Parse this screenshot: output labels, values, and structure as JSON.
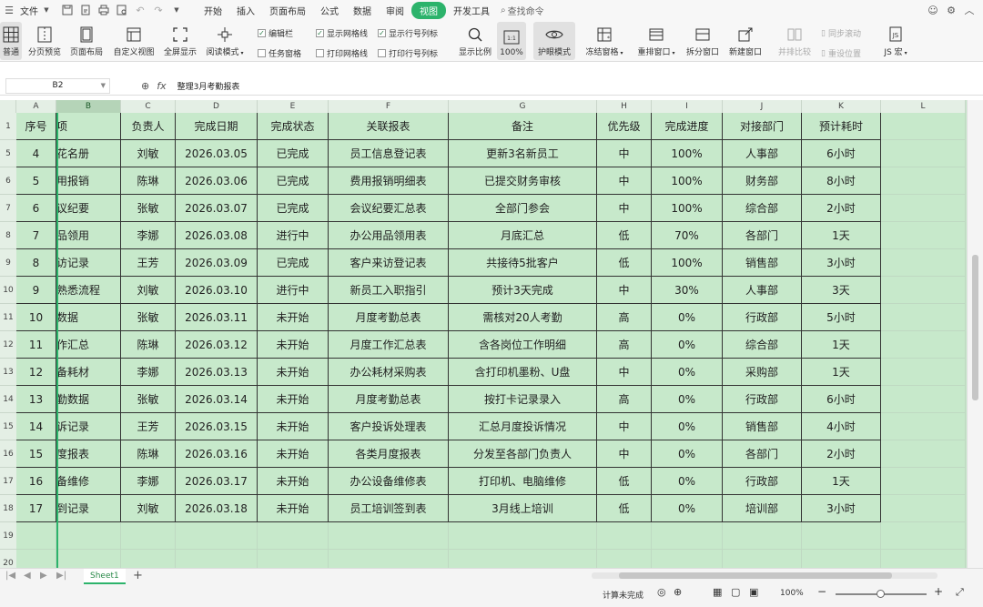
{
  "menu": {
    "file_label": "文件",
    "tabs": [
      "开始",
      "插入",
      "页面布局",
      "公式",
      "数据",
      "审阅",
      "视图",
      "开发工具"
    ],
    "active_tab": "视图",
    "search_label": "查找命令"
  },
  "ribbon": {
    "normal": "普通",
    "page_break_preview": "分页预览",
    "page_layout": "页面布局",
    "custom_view": "自定义视图",
    "full_screen": "全屏显示",
    "reading_mode": "阅读模式",
    "edit_bar": "编辑栏",
    "task_pane": "任务窗格",
    "show_gridlines": "显示网格线",
    "print_gridlines": "打印网格线",
    "show_row_col_headers": "显示行号列标",
    "print_row_col_headers": "打印行号列标",
    "zoom": "显示比例",
    "zoom_100": "100%",
    "eye_mode": "护眼模式",
    "freeze_panes": "冻结窗格",
    "arrange_windows": "重排窗口",
    "split_window": "拆分窗口",
    "new_window": "新建窗口",
    "side_by_side": "并排比较",
    "sync_scroll": "同步滚动",
    "reset_position": "重设位置",
    "js_macro": "JS 宏",
    "icon_normal": "grid-icon"
  },
  "formula_bar": {
    "cell_ref": "B2",
    "fx": "fx",
    "formula": "整理3月考勤报表"
  },
  "columns": [
    "A",
    "B",
    "C",
    "D",
    "E",
    "F",
    "G",
    "H",
    "I",
    "J",
    "K",
    "L"
  ],
  "header_row": {
    "row_num": "1",
    "cells": [
      "序号",
      "项",
      "负责人",
      "完成日期",
      "完成状态",
      "关联报表",
      "备注",
      "优先级",
      "完成进度",
      "对接部门",
      "预计耗时"
    ]
  },
  "rows": [
    {
      "num": "5",
      "cells": [
        "4",
        "花名册",
        "刘敏",
        "2026.03.05",
        "已完成",
        "员工信息登记表",
        "更新3名新员工",
        "中",
        "100%",
        "人事部",
        "6小时"
      ]
    },
    {
      "num": "6",
      "cells": [
        "5",
        "用报销",
        "陈琳",
        "2026.03.06",
        "已完成",
        "费用报销明细表",
        "已提交财务审核",
        "中",
        "100%",
        "财务部",
        "8小时"
      ]
    },
    {
      "num": "7",
      "cells": [
        "6",
        "议纪要",
        "张敏",
        "2026.03.07",
        "已完成",
        "会议纪要汇总表",
        "全部门参会",
        "中",
        "100%",
        "综合部",
        "2小时"
      ]
    },
    {
      "num": "8",
      "cells": [
        "7",
        "品领用",
        "李娜",
        "2026.03.08",
        "进行中",
        "办公用品领用表",
        "月底汇总",
        "低",
        "70%",
        "各部门",
        "1天"
      ]
    },
    {
      "num": "9",
      "cells": [
        "8",
        "访记录",
        "王芳",
        "2026.03.09",
        "已完成",
        "客户来访登记表",
        "共接待5批客户",
        "低",
        "100%",
        "销售部",
        "3小时"
      ]
    },
    {
      "num": "10",
      "cells": [
        "9",
        "熟悉流程",
        "刘敏",
        "2026.03.10",
        "进行中",
        "新员工入职指引",
        "预计3天完成",
        "中",
        "30%",
        "人事部",
        "3天"
      ]
    },
    {
      "num": "11",
      "cells": [
        "10",
        "数据",
        "张敏",
        "2026.03.11",
        "未开始",
        "月度考勤总表",
        "需核对20人考勤",
        "高",
        "0%",
        "行政部",
        "5小时"
      ]
    },
    {
      "num": "12",
      "cells": [
        "11",
        "作汇总",
        "陈琳",
        "2026.03.12",
        "未开始",
        "月度工作汇总表",
        "含各岗位工作明细",
        "高",
        "0%",
        "综合部",
        "1天"
      ]
    },
    {
      "num": "13",
      "cells": [
        "12",
        "备耗材",
        "李娜",
        "2026.03.13",
        "未开始",
        "办公耗材采购表",
        "含打印机墨粉、U盘",
        "中",
        "0%",
        "采购部",
        "1天"
      ]
    },
    {
      "num": "14",
      "cells": [
        "13",
        "勤数据",
        "张敏",
        "2026.03.14",
        "未开始",
        "月度考勤总表",
        "按打卡记录录入",
        "高",
        "0%",
        "行政部",
        "6小时"
      ]
    },
    {
      "num": "15",
      "cells": [
        "14",
        "诉记录",
        "王芳",
        "2026.03.15",
        "未开始",
        "客户投诉处理表",
        "汇总月度投诉情况",
        "中",
        "0%",
        "销售部",
        "4小时"
      ]
    },
    {
      "num": "16",
      "cells": [
        "15",
        "度报表",
        "陈琳",
        "2026.03.16",
        "未开始",
        "各类月度报表",
        "分发至各部门负责人",
        "中",
        "0%",
        "各部门",
        "2小时"
      ]
    },
    {
      "num": "17",
      "cells": [
        "16",
        "备维修",
        "李娜",
        "2026.03.17",
        "未开始",
        "办公设备维修表",
        "打印机、电脑维修",
        "低",
        "0%",
        "行政部",
        "1天"
      ]
    },
    {
      "num": "18",
      "cells": [
        "17",
        "到记录",
        "刘敏",
        "2026.03.18",
        "未开始",
        "员工培训签到表",
        "3月线上培训",
        "低",
        "0%",
        "培训部",
        "3小时"
      ]
    }
  ],
  "empty_rows": [
    "19",
    "20"
  ],
  "sheet": {
    "name": "Sheet1",
    "add": "+"
  },
  "status_bar": {
    "calc_status": "计算未完成",
    "zoom": "100%"
  },
  "colors": {
    "accent": "#2cb36b",
    "eye_mode_bg": "#c7e9cb"
  }
}
